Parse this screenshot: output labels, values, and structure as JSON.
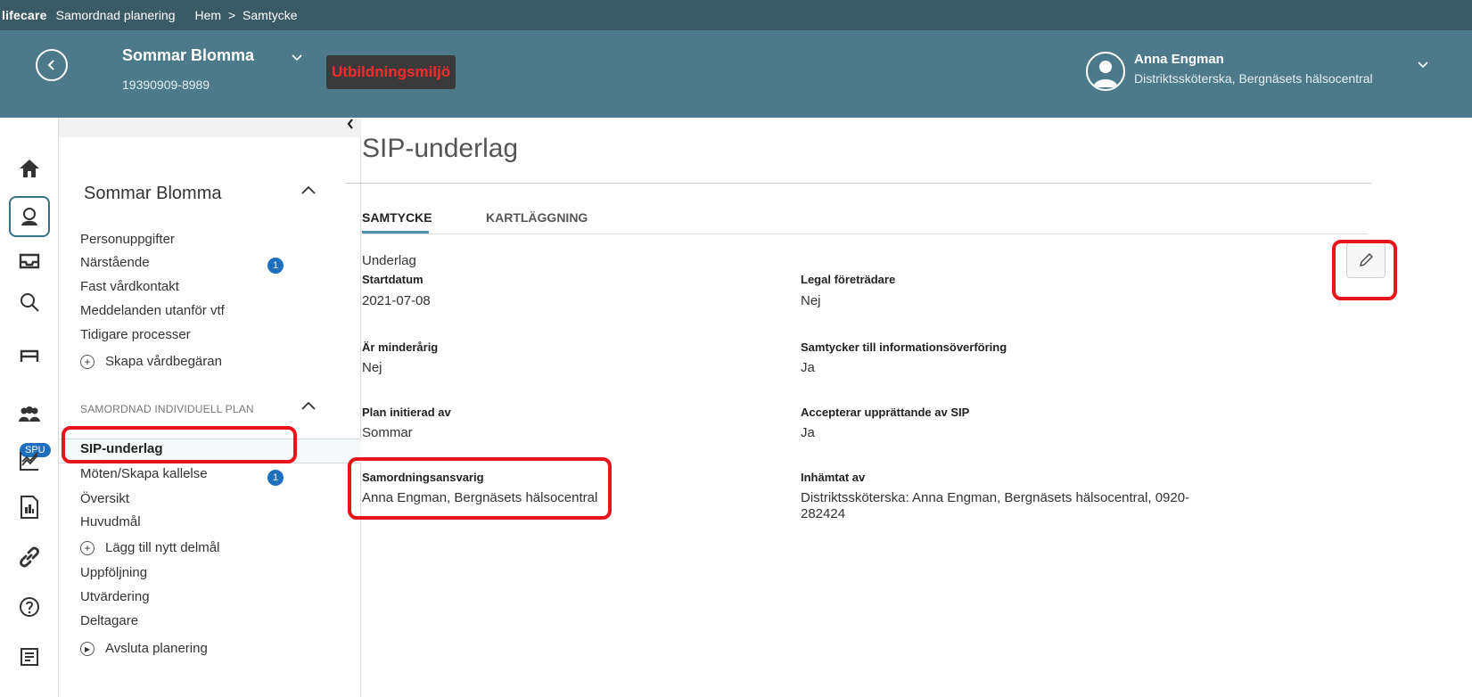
{
  "topbar": {
    "brand": "lifecare",
    "app_name": "Samordnad planering",
    "breadcrumb": [
      "Hem",
      "Samtycke"
    ],
    "breadcrumb_separator": ">"
  },
  "header": {
    "patient_name": "Sommar Blomma",
    "patient_id": "19390909-8989",
    "environment": "Utbildningsmiljö",
    "user_name": "Anna Engman",
    "user_role": "Distriktssköterska, Bergnäsets hälsocentral",
    "colors": {
      "top_strip": "#3b5a68",
      "header": "#4d7a8a",
      "environment_text": "#ff2b2b"
    }
  },
  "rail": {
    "icons": [
      "home-icon",
      "patient-icon",
      "inbox-icon",
      "search-icon",
      "bed-icon",
      "group-icon",
      "chart-icon",
      "report-icon",
      "link-icon",
      "help-icon",
      "document-icon"
    ],
    "spu_badge": "SPU"
  },
  "sidebar": {
    "patient_name": "Sommar Blomma",
    "items": [
      {
        "label": "Personuppgifter"
      },
      {
        "label": "Närstående",
        "badge": "1"
      },
      {
        "label": "Fast vårdkontakt"
      },
      {
        "label": "Meddelanden utanför vtf"
      },
      {
        "label": "Tidigare processer"
      }
    ],
    "add_care_request": "Skapa vårdbegäran",
    "section_title": "SAMORDNAD INDIVIDUELL PLAN",
    "plan_items": [
      {
        "label": "SIP-underlag",
        "active": true
      },
      {
        "label": "Möten/Skapa kallelse",
        "badge": "1"
      },
      {
        "label": "Översikt"
      },
      {
        "label": "Huvudmål"
      }
    ],
    "add_subgoal": "Lägg till nytt delmål",
    "plan_items_2": [
      {
        "label": "Uppföljning"
      },
      {
        "label": "Utvärdering"
      },
      {
        "label": "Deltagare"
      }
    ],
    "end_planning": "Avsluta planering"
  },
  "main": {
    "title": "SIP-underlag",
    "tabs": [
      {
        "label": "SAMTYCKE",
        "active": true
      },
      {
        "label": "KARTLÄGGNING",
        "active": false
      }
    ],
    "section_title": "Underlag",
    "fields": {
      "startdatum": {
        "label": "Startdatum",
        "value": "2021-07-08"
      },
      "legal": {
        "label": "Legal företrädare",
        "value": "Nej"
      },
      "minderarig": {
        "label": "Är minderårig",
        "value": "Nej"
      },
      "samtycker": {
        "label": "Samtycker till informationsöverföring",
        "value": "Ja"
      },
      "initierad": {
        "label": "Plan initierad av",
        "value": "Sommar"
      },
      "accepterar": {
        "label": "Accepterar upprättande av SIP",
        "value": "Ja"
      },
      "ansvarig": {
        "label": "Samordningsansvarig",
        "value": "Anna Engman, Bergnäsets hälsocentral"
      },
      "inhamtat": {
        "label": "Inhämtat av",
        "value_line1": "Distriktssköterska: Anna Engman, Bergnäsets hälsocentral, 0920-",
        "value_line2": "282424"
      }
    }
  },
  "highlight_color": "#e8141c"
}
